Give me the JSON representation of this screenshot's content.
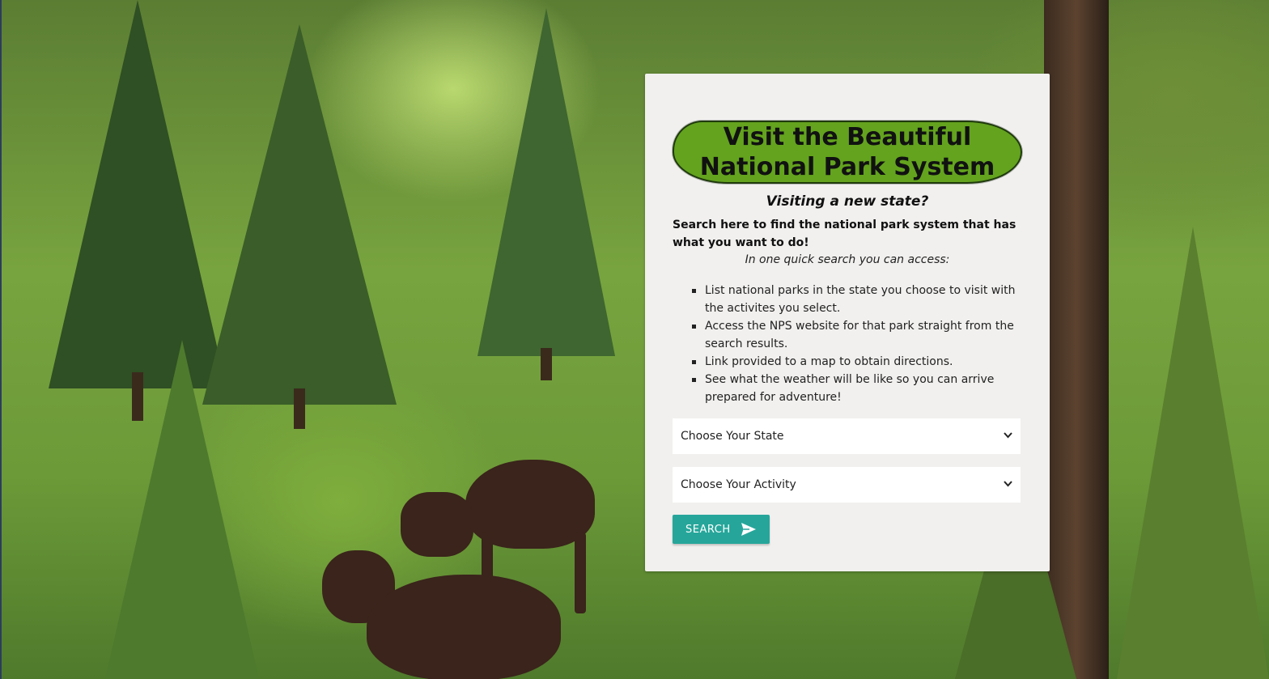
{
  "background": {
    "description_icon": "forest-moose-photo"
  },
  "card": {
    "title": "Visit the Beautiful\nNational Park System",
    "subtitle": "Visiting a new state?",
    "intro": "Search here to find the national park system that has what you want to do!",
    "access_note": "In one quick search you can access:",
    "features": [
      "List national parks in the state you choose to visit with the activites you select.",
      "Access the NPS website for that park straight from the search results.",
      "Link provided to a map to obtain directions.",
      "See what the weather will be like so you can arrive prepared for adventure!"
    ],
    "state_select": "Choose Your State",
    "activity_select": "Choose Your Activity",
    "search_label": "SEARCH"
  },
  "colors": {
    "title_bg": "#63a31e",
    "button_bg": "#26a69a",
    "card_bg": "#f1f0ee"
  }
}
